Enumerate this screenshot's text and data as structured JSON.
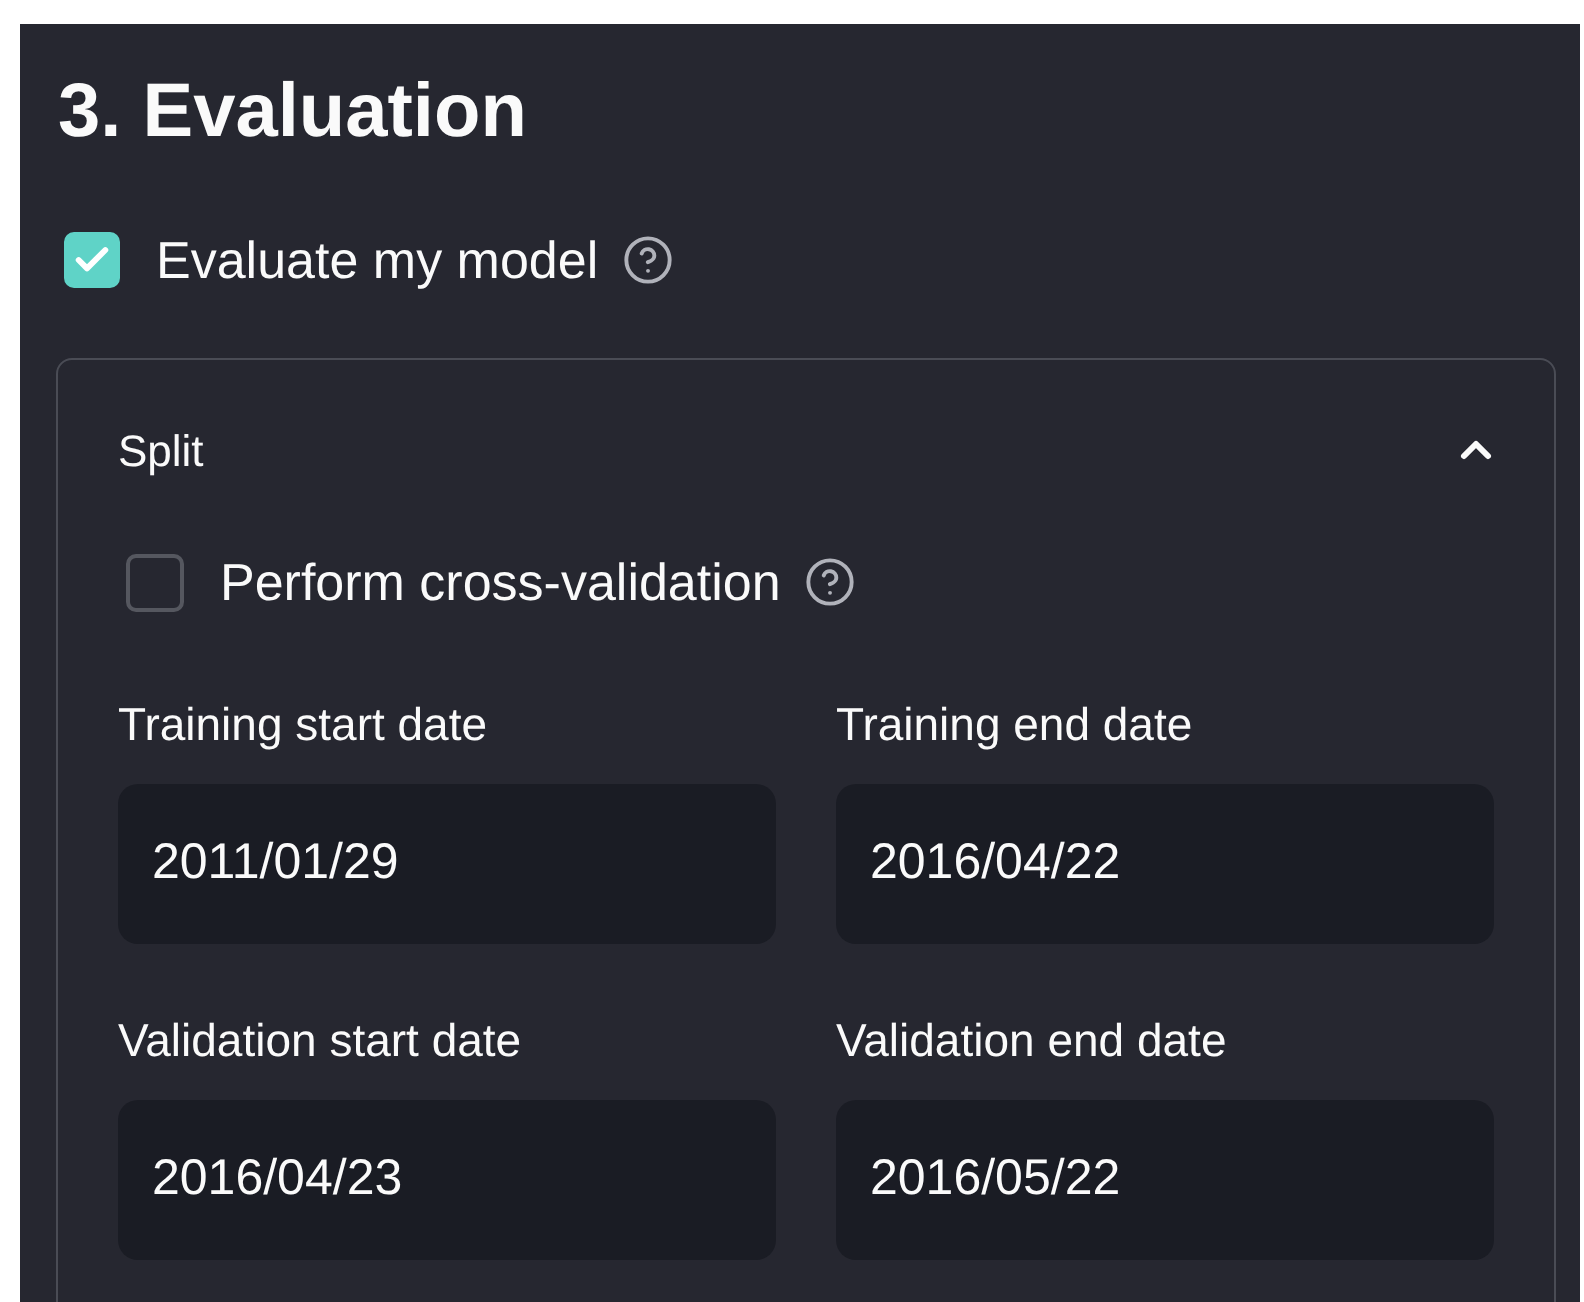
{
  "title": "3. Evaluation",
  "evaluate": {
    "label": "Evaluate my model",
    "checked": true
  },
  "expander": {
    "title": "Split",
    "expanded": true,
    "cross_validation": {
      "label": "Perform cross-validation",
      "checked": false
    },
    "fields": [
      {
        "label": "Training start date",
        "value": "2011/01/29"
      },
      {
        "label": "Training end date",
        "value": "2016/04/22"
      },
      {
        "label": "Validation start date",
        "value": "2016/04/23"
      },
      {
        "label": "Validation end date",
        "value": "2016/05/22"
      }
    ]
  }
}
